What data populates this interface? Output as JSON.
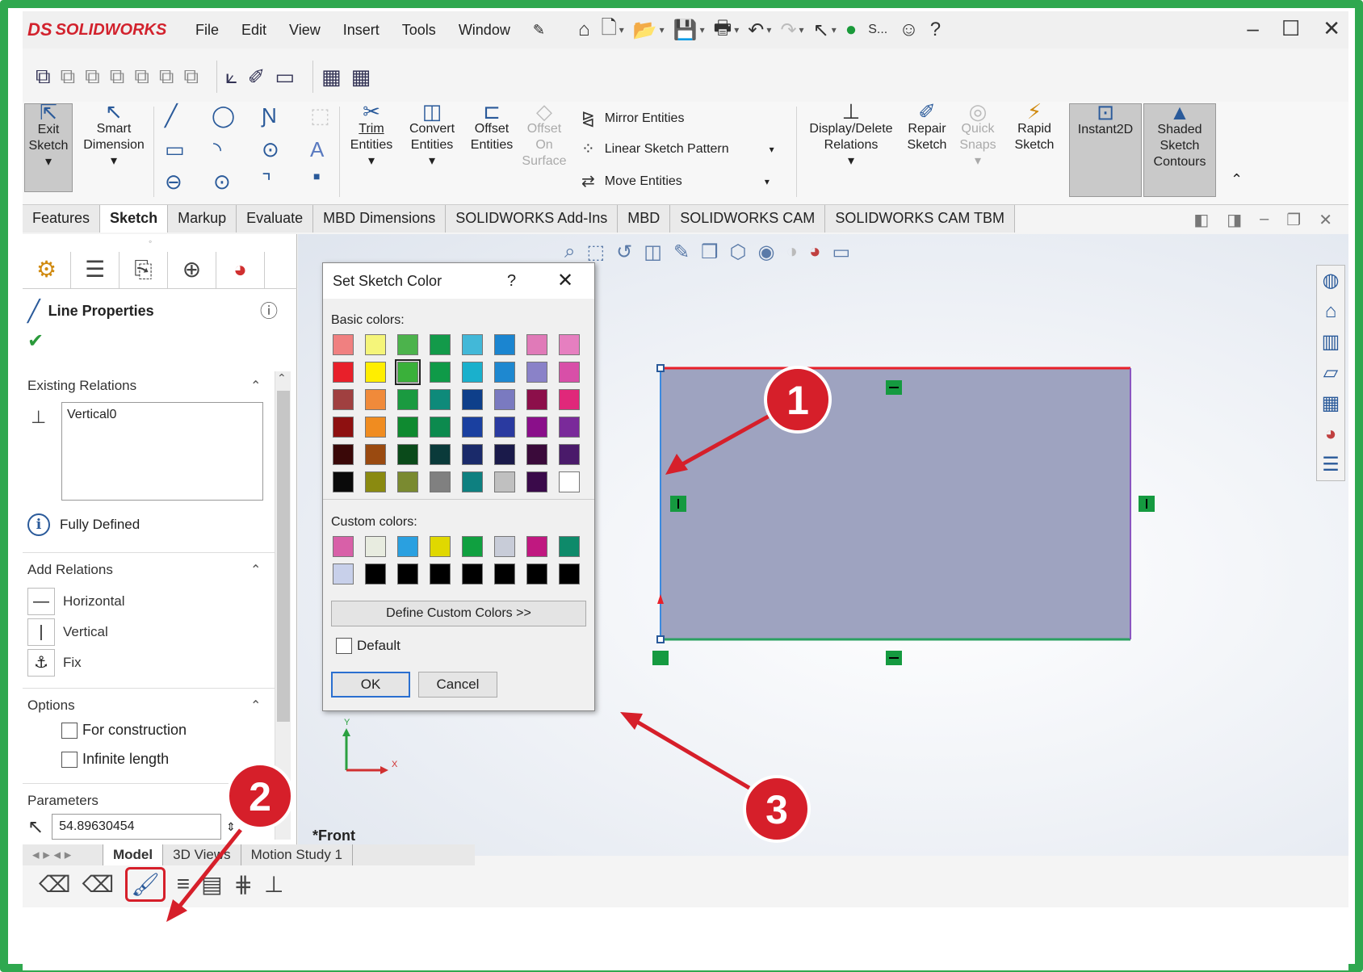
{
  "app": {
    "brand_prefix": "DS",
    "brand": "SOLIDWORKS"
  },
  "menu": [
    "File",
    "Edit",
    "View",
    "Insert",
    "Tools",
    "Window"
  ],
  "titlebar": {
    "search_label": "S..."
  },
  "ribbon": {
    "exit_sketch": [
      "Exit",
      "Sketch"
    ],
    "smart_dimension": [
      "Smart",
      "Dimension"
    ],
    "trim": [
      "Trim",
      "Entities"
    ],
    "convert": [
      "Convert",
      "Entities"
    ],
    "offset": [
      "Offset",
      "Entities"
    ],
    "offset_surface": [
      "Offset",
      "On",
      "Surface"
    ],
    "mirror": "Mirror Entities",
    "linear_pattern": "Linear Sketch Pattern",
    "move": "Move Entities",
    "display_relations": [
      "Display/Delete",
      "Relations"
    ],
    "repair": [
      "Repair",
      "Sketch"
    ],
    "quick_snaps": [
      "Quick",
      "Snaps"
    ],
    "rapid": [
      "Rapid",
      "Sketch"
    ],
    "instant2d": "Instant2D",
    "shaded": [
      "Shaded",
      "Sketch",
      "Contours"
    ]
  },
  "tabs": [
    "Features",
    "Sketch",
    "Markup",
    "Evaluate",
    "MBD Dimensions",
    "SOLIDWORKS Add-Ins",
    "MBD",
    "SOLIDWORKS CAM",
    "SOLIDWORKS CAM TBM"
  ],
  "active_tab": "Sketch",
  "panel": {
    "title": "Line Properties",
    "existing_relations_label": "Existing Relations",
    "relations": [
      "Vertical0"
    ],
    "status": "Fully Defined",
    "add_relations_label": "Add Relations",
    "add_relations": [
      "Horizontal",
      "Vertical",
      "Fix"
    ],
    "options_label": "Options",
    "options": [
      "For construction",
      "Infinite length"
    ],
    "parameters_label": "Parameters",
    "parameter_value": "54.89630454"
  },
  "dialog": {
    "title": "Set Sketch Color",
    "help": "?",
    "basic_label": "Basic colors:",
    "basic_colors": [
      "#f08080",
      "#f5f57a",
      "#4cb34c",
      "#139a4a",
      "#42b8d8",
      "#1b85d0",
      "#e07ab8",
      "#e67fc0",
      "#e8202a",
      "#ffee00",
      "#3ab03a",
      "#0f9a48",
      "#1ab0cc",
      "#1e88d0",
      "#8a82c8",
      "#d84fa8",
      "#a04040",
      "#f08a3a",
      "#1a9a40",
      "#0e8a7a",
      "#0e3f8a",
      "#7a7ac0",
      "#8c0f4a",
      "#e0287a",
      "#8e1010",
      "#f08c20",
      "#0f8a30",
      "#0c8a4e",
      "#1a40a0",
      "#2a3aa0",
      "#8a0f8a",
      "#7a2a9a",
      "#3a0808",
      "#9a4a10",
      "#0a4a1a",
      "#0a3a3a",
      "#1a2a6a",
      "#1a1a4a",
      "#3a0a3a",
      "#4a1a6a",
      "#0a0a0a",
      "#8a8a10",
      "#7a8a30",
      "#808080",
      "#0e8080",
      "#c0c0c0",
      "#3a0a4a",
      "#ffffff"
    ],
    "selected_basic": 10,
    "custom_label": "Custom colors:",
    "custom_colors": [
      "#d860a8",
      "#e8ece0",
      "#2aa0e0",
      "#e0d800",
      "#10a040",
      "#c8ccd8",
      "#c01880",
      "#0e8a6a",
      "#c8d0ea",
      "#000000",
      "#000000",
      "#000000",
      "#000000",
      "#000000",
      "#000000",
      "#000000"
    ],
    "define_custom": "Define Custom Colors >>",
    "default_label": "Default",
    "ok": "OK",
    "cancel": "Cancel"
  },
  "viewport": {
    "view_label": "*Front",
    "axis_y": "Y",
    "axis_x": "X"
  },
  "bottom_tabs": [
    "Model",
    "3D Views",
    "Motion Study 1"
  ],
  "callouts": [
    "1",
    "2",
    "3"
  ],
  "colors": {
    "callout": "#d61f2a",
    "sketch_fill": "#9ea3c0",
    "sketch_top": "#e8202a",
    "sketch_left": "#3a8ae0",
    "sketch_bottom": "#2aa060",
    "sketch_right": "#8a55c0"
  }
}
